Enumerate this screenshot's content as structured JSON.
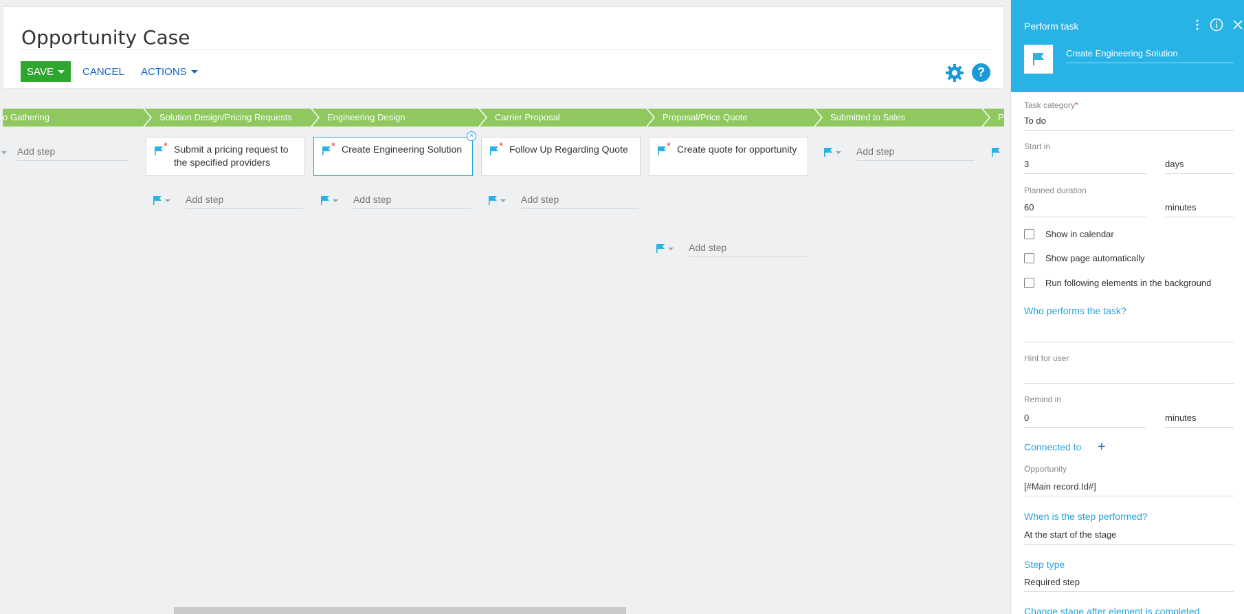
{
  "header": {
    "title": "Opportunity Case",
    "save_label": "SAVE",
    "cancel_label": "CANCEL",
    "actions_label": "ACTIONS",
    "help_label": "?"
  },
  "stages": [
    {
      "label": "o Gathering"
    },
    {
      "label": "Solution Design/Pricing Requests"
    },
    {
      "label": "Engineering Design"
    },
    {
      "label": "Carrier Proposal"
    },
    {
      "label": "Proposal/Price Quote"
    },
    {
      "label": "Submitted to Sales"
    },
    {
      "label": "P"
    }
  ],
  "steps": [
    {
      "text": "Submit a pricing request to the specified providers",
      "required_mark": "*"
    },
    {
      "text": "Create Engineering Solution",
      "required_mark": "*",
      "selected": true
    },
    {
      "text": "Follow Up Regarding Quote",
      "required_mark": "*"
    },
    {
      "text": "Create quote for opportunity",
      "required_mark": "*"
    }
  ],
  "add_step_label": "Add step",
  "remove_glyph": "×",
  "panel": {
    "title": "Perform task",
    "task_name": "Create Engineering Solution",
    "task_category": {
      "label": "Task category",
      "required_mark": "*",
      "value": "To do"
    },
    "start_in": {
      "label": "Start in",
      "value": "3",
      "unit": "days"
    },
    "planned_duration": {
      "label": "Planned duration",
      "value": "60",
      "unit": "minutes"
    },
    "checkboxes": [
      {
        "label": "Show in calendar",
        "checked": false
      },
      {
        "label": "Show page automatically",
        "checked": false
      },
      {
        "label": "Run following elements in the background",
        "checked": false
      }
    ],
    "who_performs": "Who performs the task?",
    "hint_label": "Hint for user",
    "remind_in": {
      "label": "Remind in",
      "value": "0",
      "unit": "minutes"
    },
    "connected_to": "Connected to",
    "plus_glyph": "+",
    "opportunity": {
      "label": "Opportunity",
      "value": "[#Main record.Id#]"
    },
    "when_performed": {
      "label": "When is the step performed?",
      "value": "At the start of the stage"
    },
    "step_type": {
      "label": "Step type",
      "value": "Required step"
    },
    "change_stage": "Change stage after element is completed"
  },
  "colors": {
    "stage_green": "#8ec85f",
    "save_green": "#2fa72e",
    "accent_blue": "#27b3e6",
    "link_blue": "#1565c0",
    "required_red": "#e23b3b"
  }
}
